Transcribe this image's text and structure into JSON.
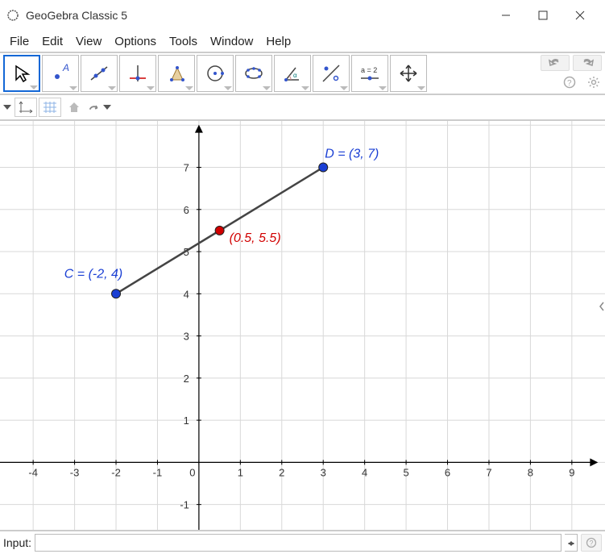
{
  "window": {
    "title": "GeoGebra Classic 5"
  },
  "menu": {
    "items": [
      "File",
      "Edit",
      "View",
      "Options",
      "Tools",
      "Window",
      "Help"
    ]
  },
  "toolbar": {
    "tools": [
      {
        "name": "move-pointer-tool"
      },
      {
        "name": "point-tool"
      },
      {
        "name": "line-tool"
      },
      {
        "name": "perpendicular-tool"
      },
      {
        "name": "polygon-tool"
      },
      {
        "name": "circle-tool"
      },
      {
        "name": "conic-tool"
      },
      {
        "name": "angle-tool"
      },
      {
        "name": "reflect-tool"
      },
      {
        "name": "slider-tool"
      },
      {
        "name": "move-graphics-tool"
      }
    ],
    "slider_label": "a = 2"
  },
  "input": {
    "label": "Input:",
    "value": "",
    "placeholder": ""
  },
  "chart_data": {
    "type": "scatter",
    "title": "",
    "xlabel": "",
    "ylabel": "",
    "xlim": [
      -4.8,
      9.8
    ],
    "ylim": [
      -1.6,
      8.1
    ],
    "grid": true,
    "x_ticks": [
      -4,
      -3,
      -2,
      -1,
      0,
      1,
      2,
      3,
      4,
      5,
      6,
      7,
      8,
      9
    ],
    "y_ticks": [
      -1,
      1,
      2,
      3,
      4,
      5,
      6,
      7
    ],
    "points": [
      {
        "name": "C",
        "x": -2,
        "y": 4,
        "color": "#1a3fd4",
        "label": "C = (-2, 4)"
      },
      {
        "name": "midpoint",
        "x": 0.5,
        "y": 5.5,
        "color": "#d10000",
        "label": "(0.5, 5.5)"
      },
      {
        "name": "D",
        "x": 3,
        "y": 7,
        "color": "#1a3fd4",
        "label": "D = (3, 7)"
      }
    ],
    "segments": [
      {
        "from": "C",
        "to": "D",
        "color": "#444"
      }
    ]
  }
}
